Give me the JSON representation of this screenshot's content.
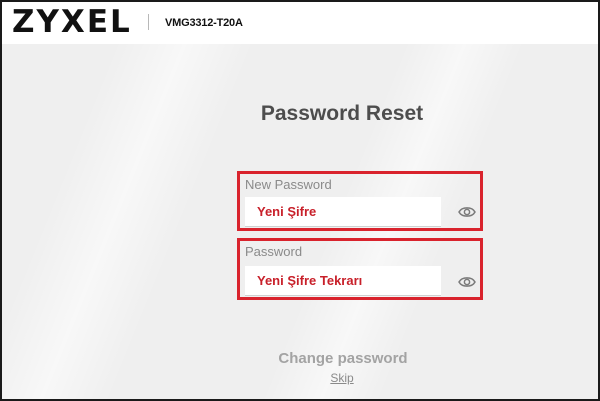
{
  "header": {
    "logo_text": "ZYXEL",
    "model": "VMG3312-T20A"
  },
  "main": {
    "title": "Password Reset",
    "new_password": {
      "label": "New Password",
      "value": "Yeni Şifre",
      "icon": "eye-icon"
    },
    "confirm_password": {
      "label": "Password",
      "value": "Yeni Şifre Tekrarı",
      "icon": "eye-icon"
    },
    "change_button_label": "Change password",
    "skip_label": "Skip"
  },
  "colors": {
    "highlight": "#d9232d",
    "input_text": "#c8202a",
    "background": "#efefef"
  }
}
